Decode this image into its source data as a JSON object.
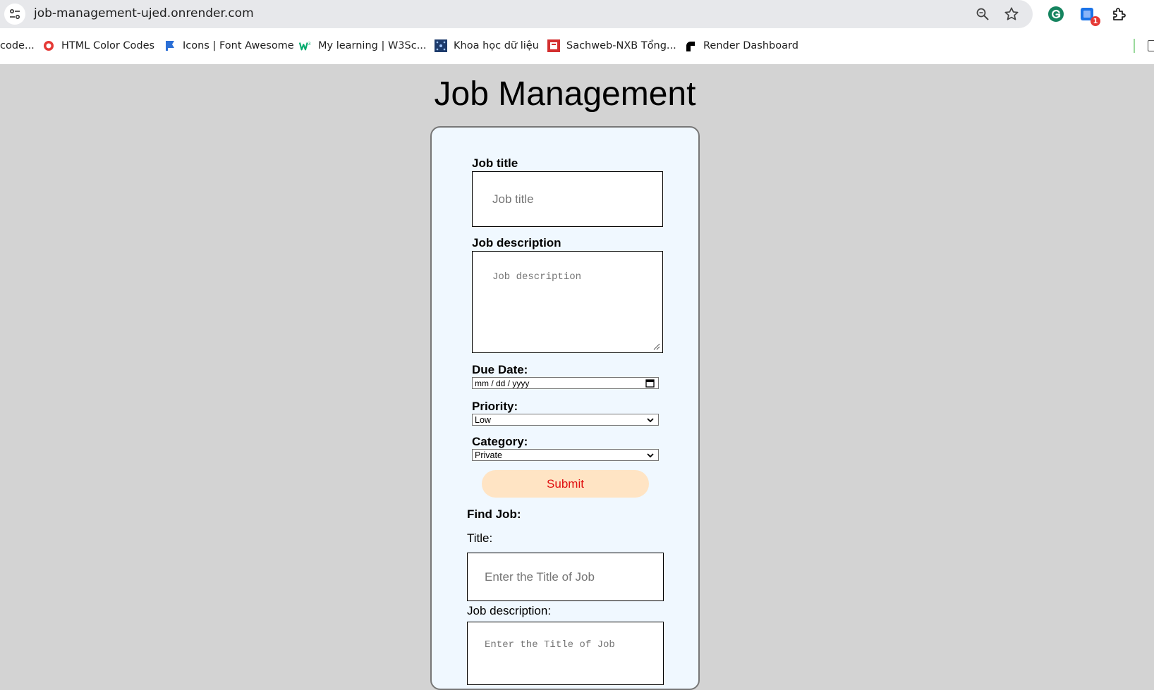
{
  "browser": {
    "url": "job-management-ujed.onrender.com",
    "extension_badge": "1",
    "bookmarks": [
      {
        "label": "code...",
        "icon": "page-icon"
      },
      {
        "label": "HTML Color Codes",
        "icon": "red-circle-icon"
      },
      {
        "label": "Icons | Font Awesome",
        "icon": "flag-icon"
      },
      {
        "label": "My learning | W3Sc...",
        "icon": "w3-icon"
      },
      {
        "label": "Khoa học dữ liệu",
        "icon": "network-icon"
      },
      {
        "label": "Sachweb-NXB Tổng...",
        "icon": "book-icon"
      },
      {
        "label": "Render Dashboard",
        "icon": "render-icon"
      }
    ]
  },
  "page": {
    "title": "Job Management",
    "form": {
      "job_title_label": "Job title",
      "job_title_placeholder": "Job title",
      "job_description_label": "Job description",
      "job_description_placeholder": "Job description",
      "due_date_label": "Due Date:",
      "due_date_placeholder": "mm / dd / yyyy",
      "priority_label": "Priority:",
      "priority_value": "Low",
      "category_label": "Category:",
      "category_value": "Private",
      "submit_label": "Submit"
    },
    "find": {
      "heading": "Find Job:",
      "title_label": "Title:",
      "title_placeholder": "Enter the Title of Job",
      "description_label": "Job description:",
      "description_placeholder": "Enter the Title of Job"
    }
  },
  "colors": {
    "page_bg": "#d3d3d3",
    "card_bg": "#f0f8ff",
    "submit_bg": "#ffe4c4",
    "submit_text": "#e01010"
  }
}
